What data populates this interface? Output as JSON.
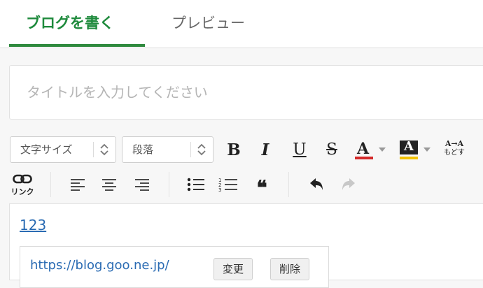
{
  "tabs": {
    "write": "ブログを書く",
    "preview": "プレビュー"
  },
  "title": {
    "placeholder": "タイトルを入力してください",
    "value": ""
  },
  "toolbar": {
    "font_size_select": "文字サイズ",
    "paragraph_select": "段落",
    "bold": "B",
    "italic": "I",
    "underline": "U",
    "strike": "S",
    "text_color": "A",
    "text_color_accent": "#d42a2a",
    "bg_color": "A",
    "bg_color_accent": "#f2c200",
    "reset_label_top": "A→A",
    "reset_label_bottom": "もどす",
    "link_label": "リンク",
    "quote": "❝"
  },
  "editor": {
    "link_text": "123",
    "popup": {
      "url": "https://blog.goo.ne.jp/",
      "change": "変更",
      "delete": "削除"
    }
  }
}
